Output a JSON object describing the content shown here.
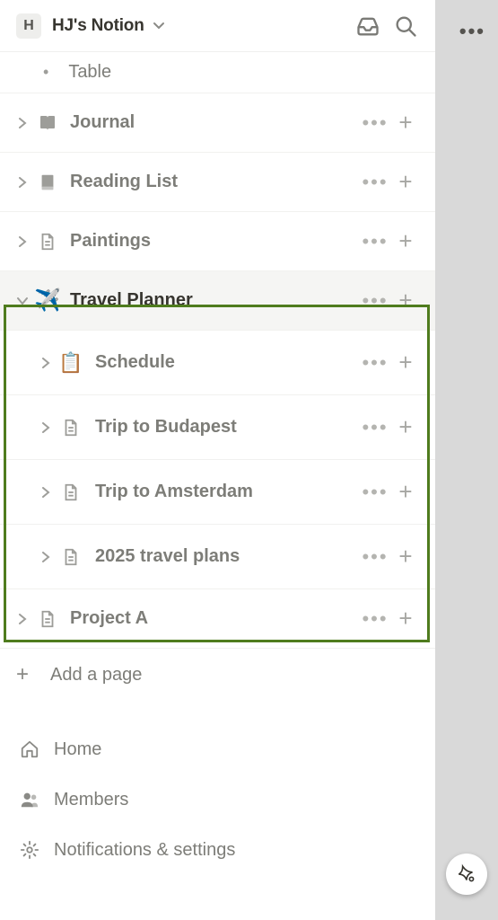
{
  "workspace": {
    "initial": "H",
    "name": "HJ's Notion"
  },
  "table_sub": {
    "label": "Table"
  },
  "pages": {
    "journal": {
      "label": "Journal"
    },
    "reading": {
      "label": "Reading List"
    },
    "paintings": {
      "label": "Paintings"
    },
    "travel": {
      "label": "Travel Planner"
    },
    "projecta": {
      "label": "Project A"
    }
  },
  "travel_children": {
    "schedule": {
      "label": "Schedule"
    },
    "budapest": {
      "label": "Trip to Budapest"
    },
    "amsterdam": {
      "label": "Trip to Amsterdam"
    },
    "plans2025": {
      "label": "2025 travel plans"
    }
  },
  "addpage": {
    "label": "Add a page"
  },
  "footer": {
    "home": "Home",
    "members": "Members",
    "settings": "Notifications & settings"
  }
}
